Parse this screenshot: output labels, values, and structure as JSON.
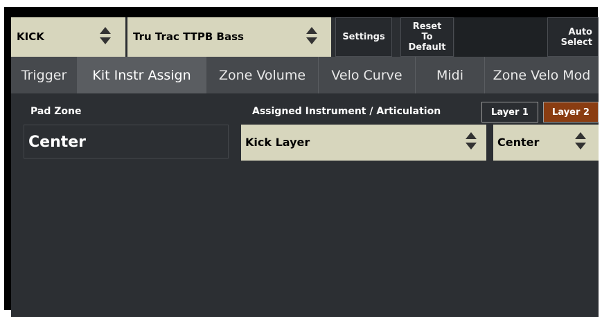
{
  "topbar": {
    "kit_select": "KICK",
    "instrument_select": "Tru Trac TTPB Bass",
    "settings_label": "Settings",
    "reset_label": [
      "Reset",
      "To",
      "Default"
    ],
    "auto_select_label": [
      "Auto",
      "Select"
    ]
  },
  "tabs": [
    {
      "label": "Trigger"
    },
    {
      "label": "Kit Instr Assign"
    },
    {
      "label": "Zone Volume"
    },
    {
      "label": "Velo Curve"
    },
    {
      "label": "Midi"
    },
    {
      "label": "Zone Velo Mod"
    }
  ],
  "active_tab": "Kit Instr Assign",
  "content": {
    "pad_zone_label": "Pad Zone",
    "assigned_label": "Assigned Instrument / Articulation",
    "layer1_label": "Layer 1",
    "layer2_label": "Layer 2",
    "active_layer": "Layer 2",
    "pad_zone_value": "Center",
    "instrument_value": "Kick Layer",
    "articulation_value": "Center"
  },
  "colors": {
    "select_bg": "#d7d6bd",
    "panel_bg": "#2c2f33",
    "tab_bg": "#46494d",
    "active_tab_bg": "#5a5d61",
    "active_layer_bg": "#8a3d12"
  },
  "icons": {
    "select_arrows": "up-down-arrows-icon"
  }
}
